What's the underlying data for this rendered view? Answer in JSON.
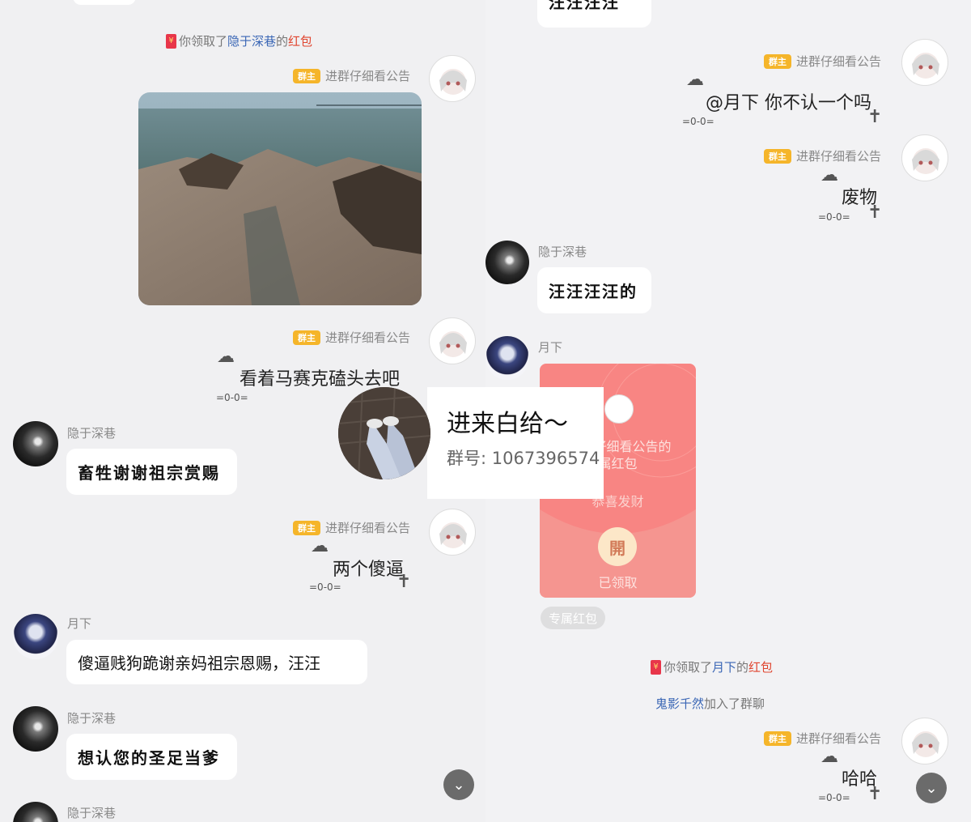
{
  "left": {
    "sys_claim": {
      "prefix": "你领取了",
      "from": "隐于深巷",
      "mid": "的",
      "packet": "红包"
    },
    "messages": [
      {
        "badge": "群主",
        "sender": "进群仔细看公告"
      },
      {
        "badge": "群主",
        "sender": "进群仔细看公告",
        "text": "看着马赛克磕头去吧"
      },
      {
        "sender": "隐于深巷",
        "text": "畜牲谢谢祖宗赏赐"
      },
      {
        "badge": "群主",
        "sender": "进群仔细看公告",
        "text": "两个傻逼"
      },
      {
        "sender": "月下",
        "text": "傻逼贱狗跪谢亲妈祖宗恩赐，汪汪"
      },
      {
        "sender": "隐于深巷",
        "text": "想认您的圣足当爹"
      },
      {
        "sender": "隐于深巷"
      }
    ],
    "doodle_mark": "=0-0="
  },
  "right": {
    "top_text": "汪汪汪汪",
    "messages": [
      {
        "badge": "群主",
        "sender": "进群仔细看公告",
        "text": "@月下 你不认一个吗"
      },
      {
        "badge": "群主",
        "sender": "进群仔细看公告",
        "text": "废物"
      },
      {
        "sender": "隐于深巷",
        "text": "汪汪汪汪的"
      },
      {
        "sender": "月下"
      }
    ],
    "red_packet": {
      "title_line1": "仔细看公告的",
      "title_line2": "属红包",
      "greeting": "恭喜发财",
      "open_char": "開",
      "status": "已领取",
      "tag": "专属红包"
    },
    "sys_claim": {
      "prefix": "你领取了",
      "from": "月下",
      "mid": "的",
      "packet": "红包"
    },
    "sys_join": {
      "who": "鬼影千然",
      "action": "加入了群聊"
    },
    "last": {
      "badge": "群主",
      "sender": "进群仔细看公告",
      "text": "哈哈"
    },
    "doodle_mark": "=0-0="
  },
  "overlay": {
    "title": "进来白给～",
    "group_label": "群号: 1067396574"
  },
  "scroll_icon": "chevron-down-icon"
}
